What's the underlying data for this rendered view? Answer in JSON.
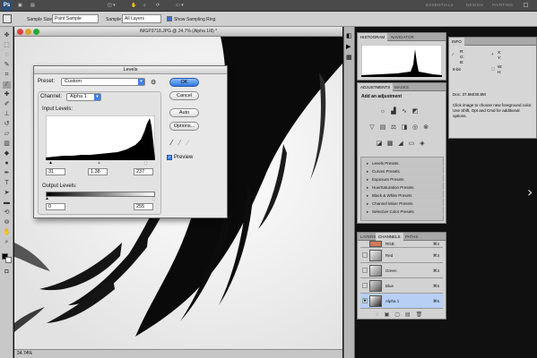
{
  "app": {
    "logo": "Ps",
    "workspaces": [
      "ESSENTIALS",
      "DESIGN",
      "PAINTING"
    ]
  },
  "options_bar": {
    "sample_size_label": "Sample Size:",
    "sample_size_value": "Point Sample",
    "sample_label": "Sample:",
    "sample_value": "All Layers",
    "show_ring_label": "Show Sampling Ring"
  },
  "document": {
    "title": "IMGP3718.JPG @ 24.7% (Alpha 1/8) *",
    "status_zoom": "24.74%"
  },
  "levels_dialog": {
    "title": "Levels",
    "preset_label": "Preset:",
    "preset_value": "Custom",
    "channel_label": "Channel:",
    "channel_value": "Alpha 1",
    "input_levels_label": "Input Levels:",
    "input_black": "31",
    "input_gamma": "1.38",
    "input_white": "237",
    "output_levels_label": "Output Levels:",
    "output_black": "0",
    "output_white": "255",
    "buttons": {
      "ok": "OK",
      "cancel": "Cancel",
      "auto": "Auto",
      "options": "Options..."
    },
    "preview_label": "Preview"
  },
  "histogram_panel": {
    "tabs": [
      "HISTOGRAM",
      "NAVIGATOR"
    ]
  },
  "adjustments_panel": {
    "tabs": [
      "ADJUSTMENTS",
      "MASKS"
    ],
    "heading": "Add an adjustment",
    "presets": [
      "Levels Presets",
      "Curves Presets",
      "Exposure Presets",
      "Hue/Saturation Presets",
      "Black & White Presets",
      "Channel Mixer Presets",
      "Selective Color Presets"
    ]
  },
  "channels_panel": {
    "tabs": [
      "LAYERS",
      "CHANNELS",
      "PATHS"
    ],
    "rows": [
      {
        "name": "RGB",
        "shortcut": "⌘2"
      },
      {
        "name": "Red",
        "shortcut": "⌘3"
      },
      {
        "name": "Green",
        "shortcut": "⌘4"
      },
      {
        "name": "Blue",
        "shortcut": "⌘5"
      },
      {
        "name": "Alpha 1",
        "shortcut": "⌘6"
      }
    ]
  },
  "info_panel": {
    "tab": "INFO",
    "r": "R:",
    "g": "G:",
    "b": "B:",
    "bit": "8-bit",
    "x": "X:",
    "y": "Y:",
    "w": "W:",
    "h": "H:",
    "doc": "Doc: 37.6M/30.8M",
    "help": "Click image to choose new foreground color. Use Shift, Opt and Cmd for additional options."
  },
  "colors": {
    "accent": "#3d7ee6",
    "panel_bg": "#d2d2d2",
    "app_bg": "#101010"
  }
}
